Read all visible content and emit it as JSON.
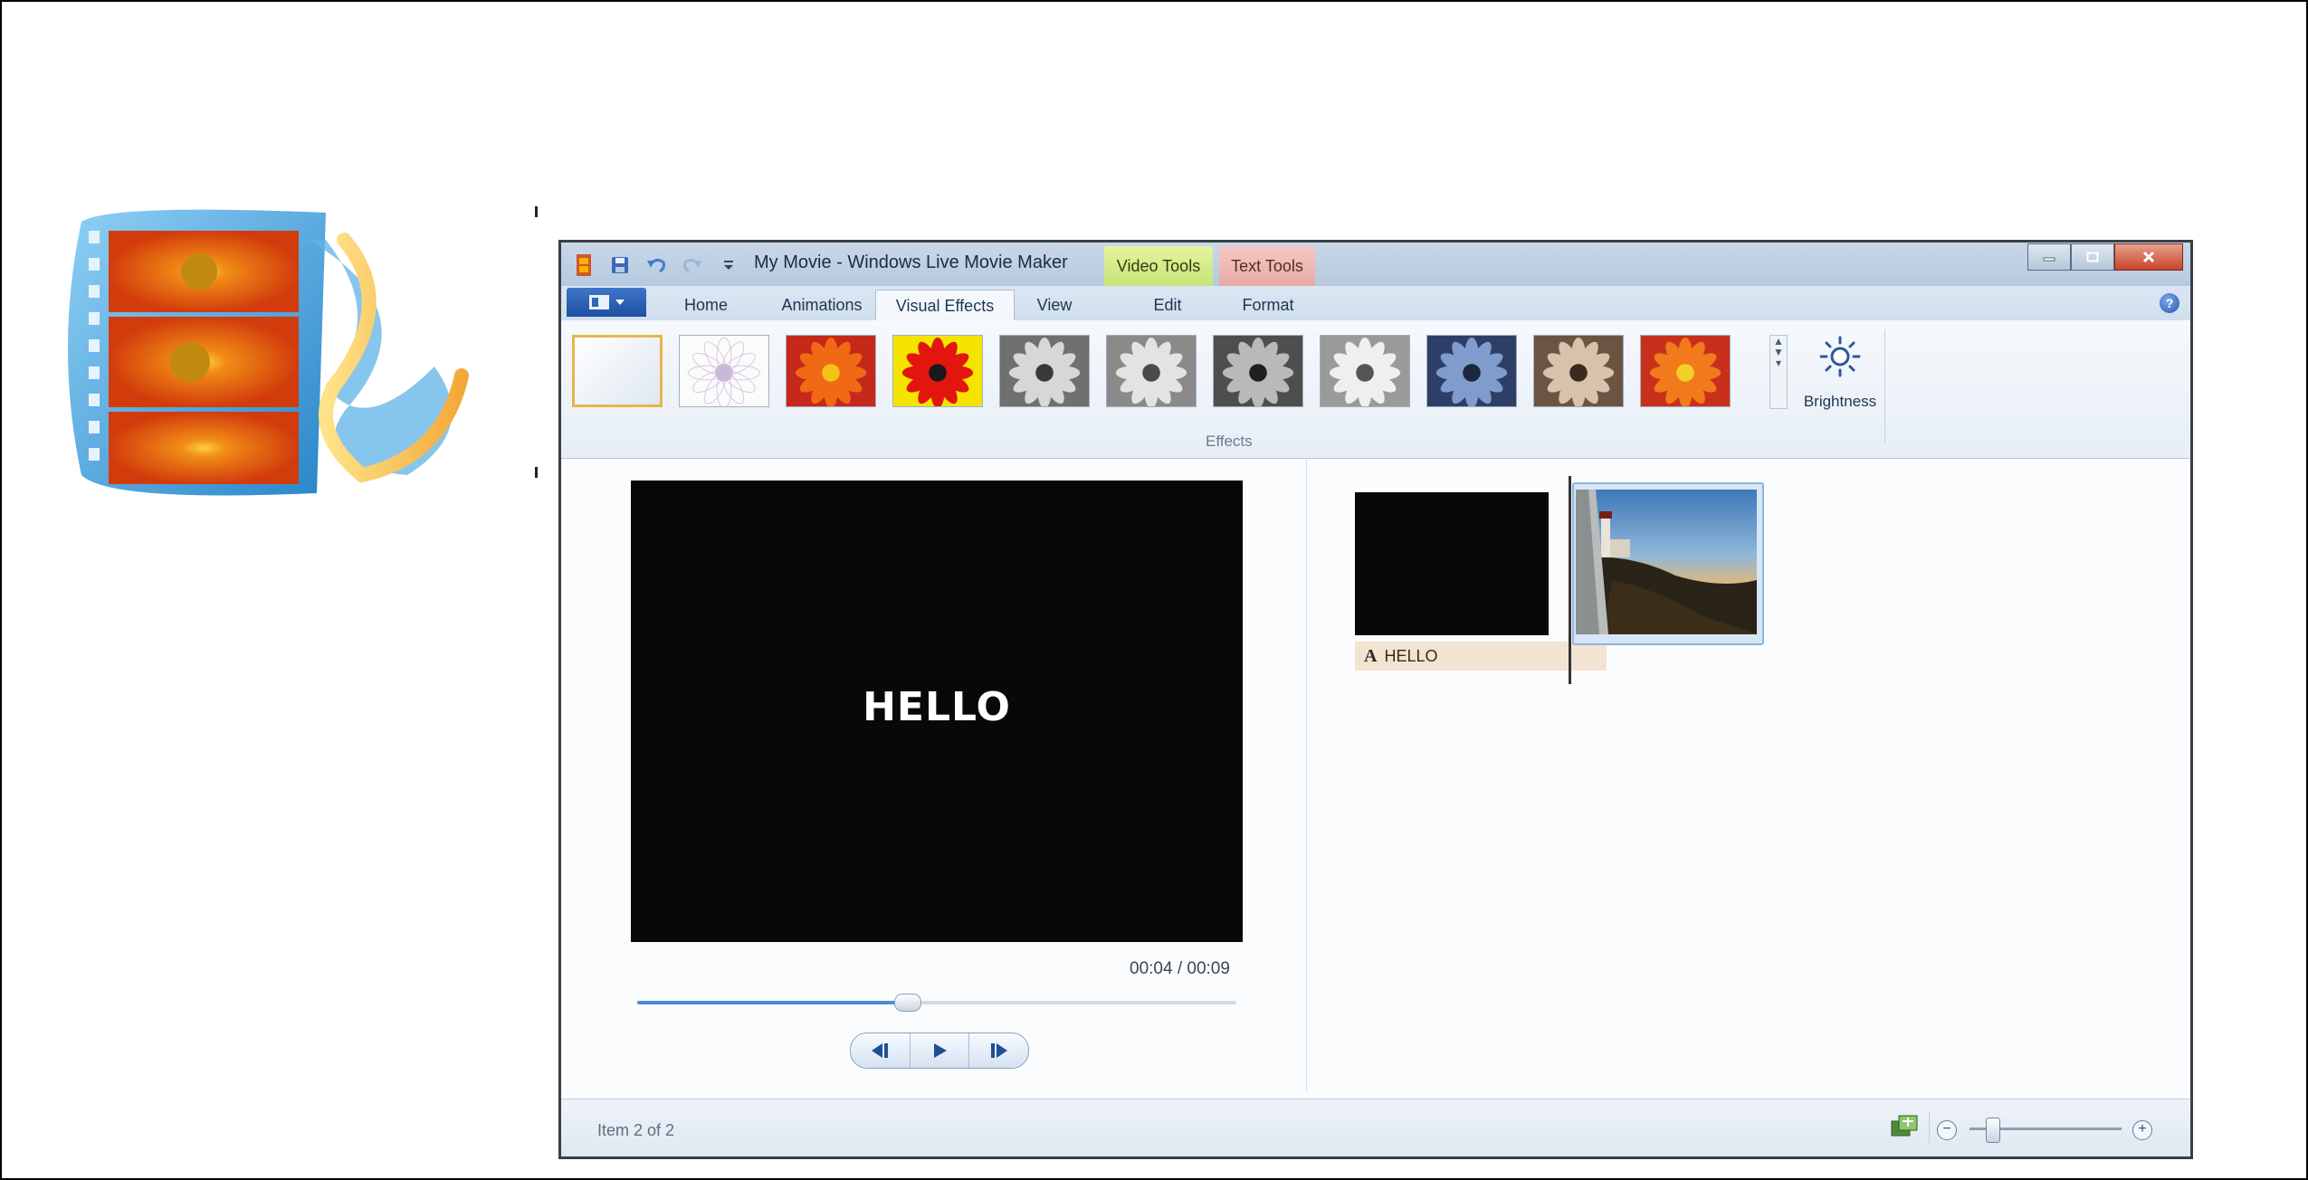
{
  "window": {
    "title": "My Movie - Windows Live Movie Maker",
    "contextual_tabs": [
      "Video Tools",
      "Text Tools"
    ]
  },
  "tabs": [
    {
      "label": "Home"
    },
    {
      "label": "Animations"
    },
    {
      "label": "Visual Effects",
      "active": true
    },
    {
      "label": "View"
    },
    {
      "label": "Edit"
    },
    {
      "label": "Format"
    }
  ],
  "ribbon": {
    "group_label": "Effects",
    "brightness_label": "Brightness",
    "effects": [
      {
        "icon": "no-effect-icon"
      },
      {
        "icon": "sketch-effect-icon"
      },
      {
        "icon": "color-effect-icon"
      },
      {
        "icon": "posterize-effect-icon"
      },
      {
        "icon": "grayscale-effect-icon"
      },
      {
        "icon": "grayscale-light-effect-icon"
      },
      {
        "icon": "grayscale-dark-effect-icon"
      },
      {
        "icon": "grayscale-soft-effect-icon"
      },
      {
        "icon": "cyan-tone-effect-icon"
      },
      {
        "icon": "sepia-effect-icon"
      },
      {
        "icon": "edge-detect-effect-icon"
      }
    ]
  },
  "preview": {
    "text": "HELLO",
    "time": "00:04 / 00:09",
    "progress": 0.45
  },
  "storyboard": {
    "caption": "HELLO",
    "caption_icon": "A"
  },
  "status": {
    "text": "Item 2 of 2",
    "zoom_level": 0.15
  },
  "colors": {
    "accent": "#4c8bd6",
    "video_tools": "#d4ea7f",
    "text_tools": "#efb9b2"
  }
}
